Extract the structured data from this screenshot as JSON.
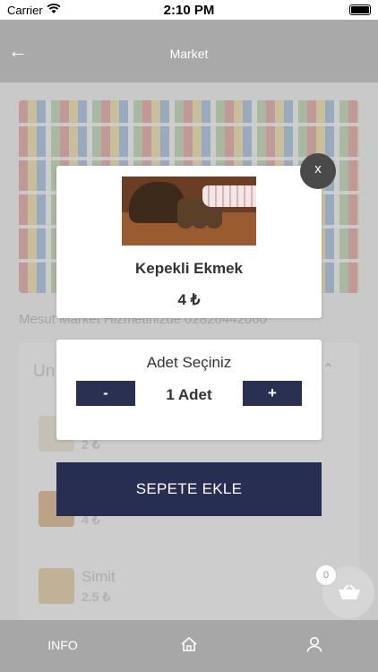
{
  "status_bar": {
    "carrier": "Carrier",
    "time": "2:10 PM"
  },
  "header": {
    "title": "Market"
  },
  "store": {
    "description": "Mesut Market Hizmetinizde 02826442060"
  },
  "category": {
    "title": "Un",
    "products": [
      {
        "name": "",
        "price": "2 ₺"
      },
      {
        "name": "",
        "price": "4 ₺"
      },
      {
        "name": "Simit",
        "price": "2.5 ₺"
      }
    ]
  },
  "popup": {
    "close_label": "x",
    "product_name": "Kepekli Ekmek",
    "price": "4 ₺"
  },
  "quantity": {
    "title": "Adet Seçiniz",
    "minus_label": "-",
    "plus_label": "+",
    "value": "1 Adet"
  },
  "add_to_cart": {
    "label": "SEPETE EKLE"
  },
  "cart": {
    "count": "0"
  },
  "tabbar": {
    "info_label": "INFO"
  },
  "colors": {
    "accent": "#282d52",
    "header": "#a9a9a9",
    "tabbar": "#a7a7a7"
  },
  "icons": [
    "back-arrow-icon",
    "wifi-icon",
    "battery-icon",
    "chevron-up-icon",
    "basket-icon",
    "home-icon",
    "user-icon"
  ]
}
